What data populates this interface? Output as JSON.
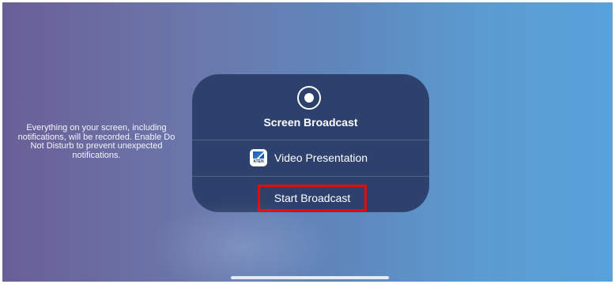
{
  "warning": {
    "text": "Everything on your screen, including notifications, will be recorded. Enable Do Not Disturb to prevent unexpected notifications."
  },
  "panel": {
    "icon": "record-icon",
    "title": "Screen Broadcast",
    "app": {
      "icon": "aten-app-icon",
      "icon_text": "ATEN",
      "name": "Video Presentation"
    },
    "start_label": "Start Broadcast"
  },
  "colors": {
    "panel_bg": "#2d416c",
    "highlight_border": "#e60b0b",
    "text": "#ffffff"
  }
}
